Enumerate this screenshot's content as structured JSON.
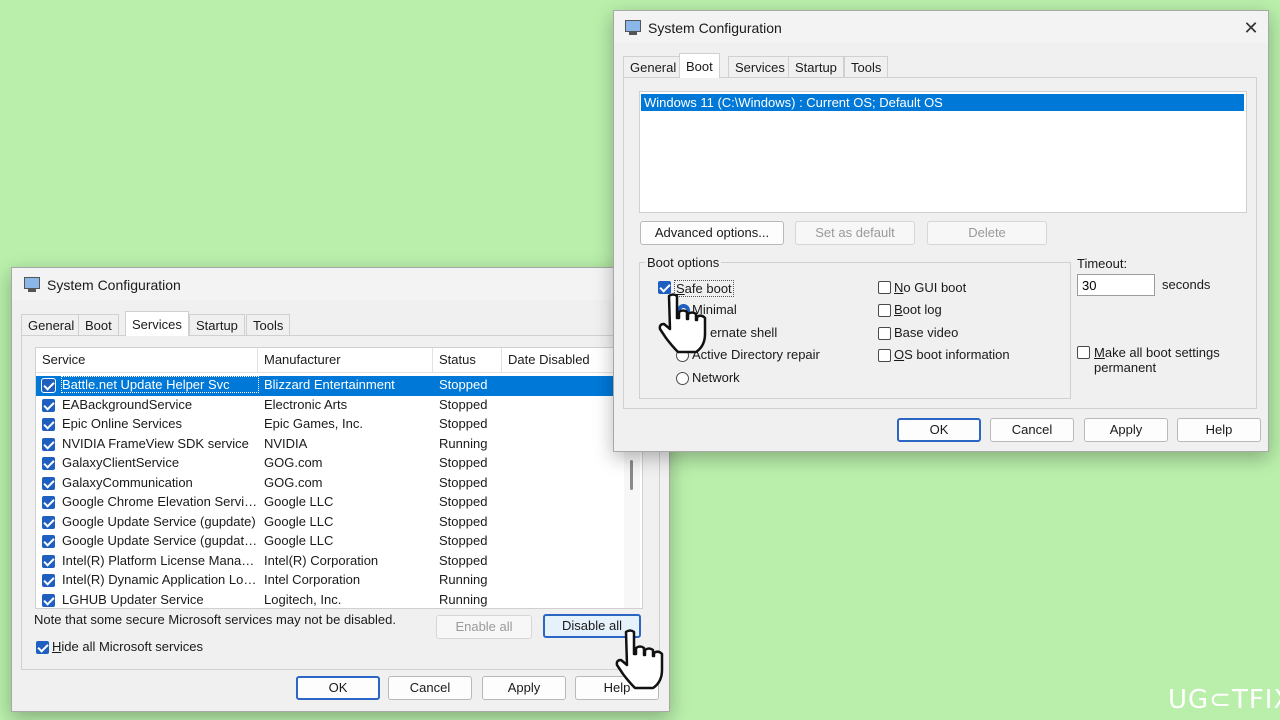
{
  "services_window": {
    "title": "System Configuration",
    "tabs": [
      "General",
      "Boot",
      "Services",
      "Startup",
      "Tools"
    ],
    "active_tab": "Services",
    "columns": [
      "Service",
      "Manufacturer",
      "Status",
      "Date Disabled"
    ],
    "rows": [
      {
        "service": "Battle.net Update Helper Svc",
        "manufacturer": "Blizzard Entertainment",
        "status": "Stopped",
        "date_disabled": "",
        "checked": true,
        "selected": true
      },
      {
        "service": "EABackgroundService",
        "manufacturer": "Electronic Arts",
        "status": "Stopped",
        "date_disabled": "",
        "checked": true
      },
      {
        "service": "Epic Online Services",
        "manufacturer": "Epic Games, Inc.",
        "status": "Stopped",
        "date_disabled": "",
        "checked": true
      },
      {
        "service": "NVIDIA FrameView SDK service",
        "manufacturer": "NVIDIA",
        "status": "Running",
        "date_disabled": "",
        "checked": true
      },
      {
        "service": "GalaxyClientService",
        "manufacturer": "GOG.com",
        "status": "Stopped",
        "date_disabled": "",
        "checked": true
      },
      {
        "service": "GalaxyCommunication",
        "manufacturer": "GOG.com",
        "status": "Stopped",
        "date_disabled": "",
        "checked": true
      },
      {
        "service": "Google Chrome Elevation Servic...",
        "manufacturer": "Google LLC",
        "status": "Stopped",
        "date_disabled": "",
        "checked": true
      },
      {
        "service": "Google Update Service (gupdate)",
        "manufacturer": "Google LLC",
        "status": "Stopped",
        "date_disabled": "",
        "checked": true
      },
      {
        "service": "Google Update Service (gupdatem)",
        "manufacturer": "Google LLC",
        "status": "Stopped",
        "date_disabled": "",
        "checked": true
      },
      {
        "service": "Intel(R) Platform License Manag...",
        "manufacturer": "Intel(R) Corporation",
        "status": "Stopped",
        "date_disabled": "",
        "checked": true
      },
      {
        "service": "Intel(R) Dynamic Application Loa...",
        "manufacturer": "Intel Corporation",
        "status": "Running",
        "date_disabled": "",
        "checked": true
      },
      {
        "service": "LGHUB Updater Service",
        "manufacturer": "Logitech, Inc.",
        "status": "Running",
        "date_disabled": "",
        "checked": true
      }
    ],
    "note": "Note that some secure Microsoft services may not be disabled.",
    "enable_all": "Enable all",
    "disable_all": "Disable all",
    "hide_ms": "Hide all Microsoft services",
    "hide_ms_checked": true,
    "buttons": {
      "ok": "OK",
      "cancel": "Cancel",
      "apply": "Apply",
      "help": "Help"
    }
  },
  "boot_window": {
    "title": "System Configuration",
    "close_glyph": "✕",
    "tabs": [
      "General",
      "Boot",
      "Services",
      "Startup",
      "Tools"
    ],
    "active_tab": "Boot",
    "os_entry": "Windows 11 (C:\\Windows) : Current OS; Default OS",
    "advanced_options": "Advanced options...",
    "set_default": "Set as default",
    "delete": "Delete",
    "boot_options_label": "Boot options",
    "safe_boot": "Safe boot",
    "safe_boot_checked": true,
    "radio_minimal": "Minimal",
    "radio_alternate": "Alternate shell",
    "radio_alternate_visible": "ernate shell",
    "radio_ad": "Active Directory repair",
    "radio_network": "Network",
    "selected_radio": "Minimal",
    "no_gui": "No GUI boot",
    "boot_log": "Boot log",
    "base_video": "Base video",
    "os_boot_info": "OS boot information",
    "timeout_label": "Timeout:",
    "timeout_value": "30",
    "seconds": "seconds",
    "make_permanent_1": "Make all boot settings",
    "make_permanent_2": "permanent",
    "buttons": {
      "ok": "OK",
      "cancel": "Cancel",
      "apply": "Apply",
      "help": "Help"
    }
  },
  "watermark": "UG⊂TFIX"
}
